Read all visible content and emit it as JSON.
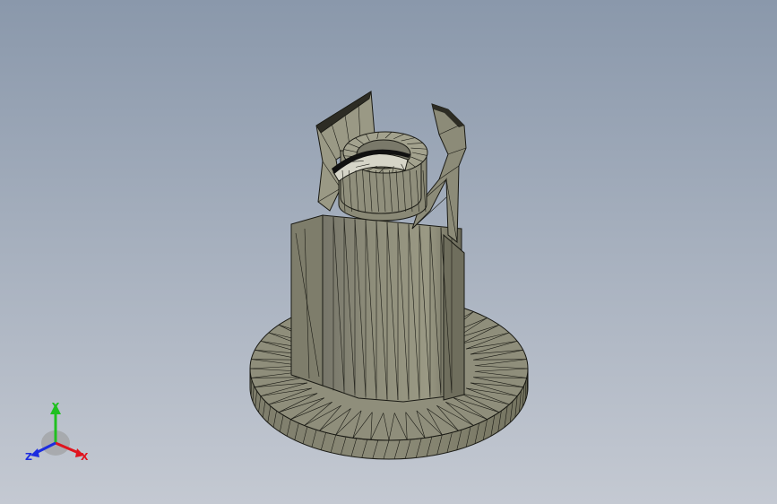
{
  "viewport": {
    "background_top": "#8a98ab",
    "background_bottom": "#c4c9d2"
  },
  "model": {
    "face_color": "#8b8a77",
    "face_light": "#a8a794",
    "face_dark": "#6f6e5d",
    "mesh_color": "#1a1a14"
  },
  "triad": {
    "x_label": "X",
    "y_label": "Y",
    "z_label": "Z",
    "x_color": "#e0141e",
    "y_color": "#20c020",
    "z_color": "#1c2ce0"
  }
}
